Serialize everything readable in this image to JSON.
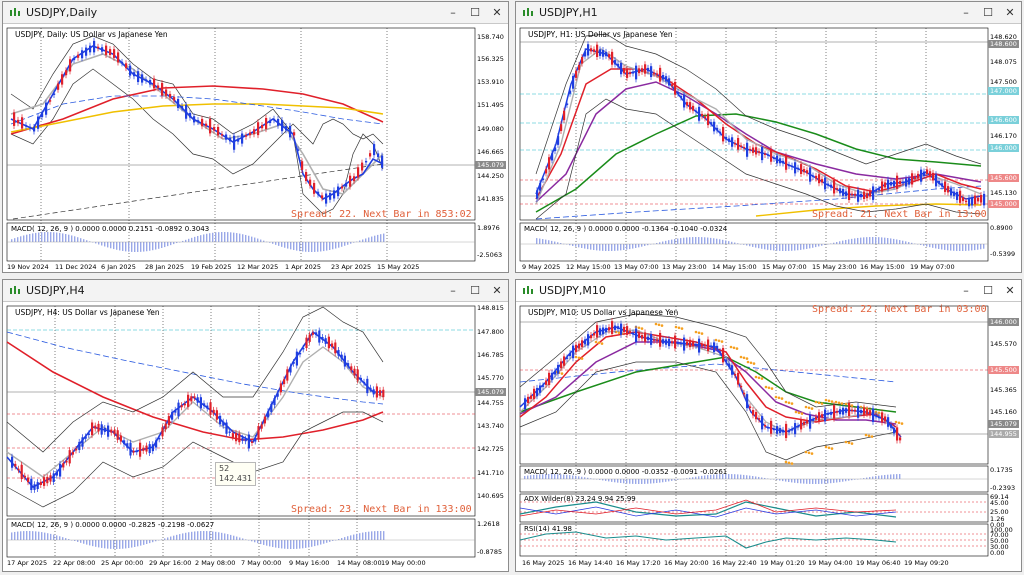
{
  "windows": [
    {
      "id": "daily",
      "title": "USDJPY,Daily",
      "label": "USDJPY, Daily:  US Dollar vs Japanese Yen",
      "spread": "Spread: 22. Next Bar in 853:02",
      "macd": "MACD( 12, 26, 9 ) 0.0000 0.0000 0.2151 -0.0892 0.3043",
      "prices": [
        "158.740",
        "156.325",
        "153.910",
        "151.495",
        "149.080",
        "146.665",
        "145.079",
        "144.250",
        "141.835"
      ],
      "current_price": "145.079",
      "macd_scale": [
        "1.8976",
        "-2.5063"
      ],
      "dates": [
        "19 Nov 2024",
        "11 Dec 2024",
        "6 Jan 2025",
        "28 Jan 2025",
        "19 Feb 2025",
        "12 Mar 2025",
        "1 Apr 2025",
        "23 Apr 2025",
        "15 May 2025"
      ]
    },
    {
      "id": "h1",
      "title": "USDJPY,H1",
      "label": "USDJPY, H1:  US Dollar vs Japanese Yen",
      "spread": "Spread: 21. Next Bar in 13:00",
      "macd": "MACD( 12, 26, 9 ) 0.0000 0.0000 -0.1364 -0.1040 -0.0324",
      "prices": [
        "148.620",
        "148.600",
        "148.075",
        "147.500",
        "147.000",
        "146.600",
        "146.170",
        "146.000",
        "145.600",
        "145.130",
        "145.000"
      ],
      "current_price": "145.079",
      "macd_scale": [
        "0.8900",
        "-0.5399"
      ],
      "dates": [
        "9 May 2025",
        "12 May 15:00",
        "13 May 07:00",
        "13 May 23:00",
        "14 May 15:00",
        "15 May 07:00",
        "15 May 23:00",
        "16 May 15:00",
        "19 May 07:00"
      ]
    },
    {
      "id": "h4",
      "title": "USDJPY,H4",
      "label": "USDJPY, H4:  US Dollar vs Japanese Yen",
      "spread": "Spread: 23. Next Bar in 133:00",
      "macd": "MACD( 12, 26, 9 ) 0.0000 0.0000 -0.2825 -0.2198 -0.0627",
      "prices": [
        "148.815",
        "147.800",
        "146.785",
        "145.770",
        "145.079",
        "144.755",
        "143.740",
        "142.725",
        "141.710",
        "140.695"
      ],
      "current_price": "145.079",
      "macd_scale": [
        "1.2618",
        "-0.8785"
      ],
      "tooltip": [
        "52",
        "142.431"
      ],
      "dates": [
        "17 Apr 2025",
        "22 Apr 08:00",
        "25 Apr 00:00",
        "29 Apr 16:00",
        "2 May 08:00",
        "7 May 00:00",
        "9 May 16:00",
        "14 May 08:00",
        "19 May 00:00"
      ]
    },
    {
      "id": "m10",
      "title": "USDJPY,M10",
      "label": "USDJPY, M10:  US Dollar vs Japanese Yen",
      "spread": "Spread: 22. Next Bar in 03:00",
      "macd": "MACD( 12, 26, 9 ) 0.0000 0.0000 -0.0352 -0.0091 -0.0261",
      "adx": "ADX Wilder(8) 23.24 9.94 25.99",
      "rsi": "RSI(14) 41.98",
      "prices": [
        "146.000",
        "145.570",
        "145.500",
        "145.365",
        "145.160",
        "145.079",
        "144.955"
      ],
      "current_price": "145.079",
      "macd_scale": [
        "0.1735",
        "-0.2393"
      ],
      "adx_scale": [
        "69.14",
        "45.00",
        "25.00",
        "1.26",
        "0.00"
      ],
      "rsi_scale": [
        "100.00",
        "70.00",
        "50.00",
        "30.00",
        "0.00"
      ],
      "dates": [
        "16 May 2025",
        "16 May 14:40",
        "16 May 17:20",
        "16 May 20:00",
        "16 May 22:40",
        "19 May 01:20",
        "19 May 04:00",
        "19 May 06:40",
        "19 May 09:20"
      ]
    }
  ],
  "colors": {
    "bull": "#1f3ee0",
    "bear": "#e0202a",
    "ma_red": "#e0202a",
    "ma_gold": "#f0c000",
    "ma_gray": "#b0b0b0",
    "ma_blue": "#2a5ae0"
  }
}
